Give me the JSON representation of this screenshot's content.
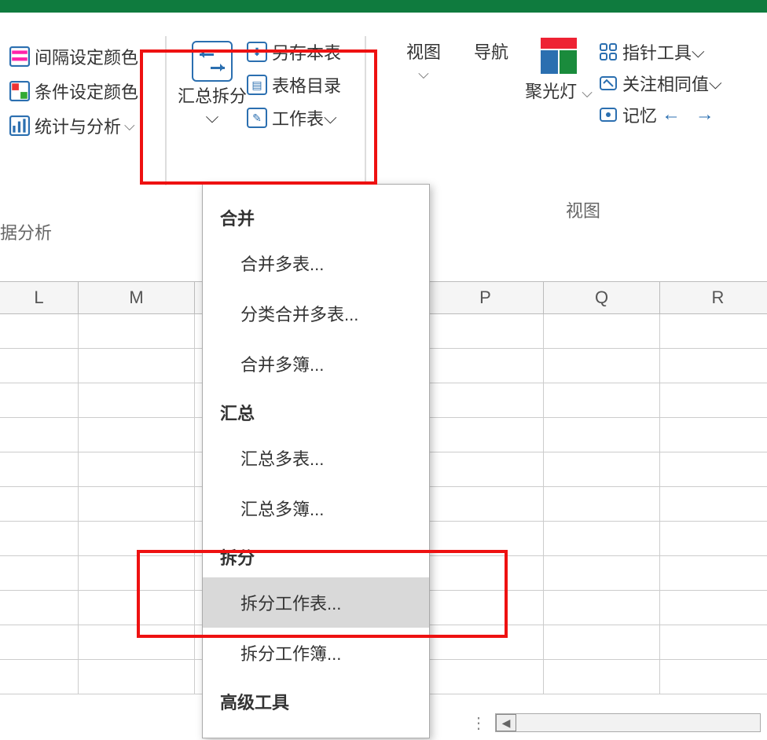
{
  "ribbon": {
    "left_group": {
      "interval_color": "间隔设定颜色",
      "conditional_color": "条件设定颜色",
      "stats_analysis": "统计与分析",
      "group_label": "据分析"
    },
    "style_group": {
      "summary_split": "汇总拆分",
      "save_table": "另存本表",
      "table_catalog": "表格目录",
      "worksheet": "工作表"
    },
    "view_group": {
      "view": "视图",
      "navigation": "导航",
      "spotlight": "聚光灯",
      "pointer_tool": "指针工具",
      "follow_same": "关注相同值",
      "memory": "记忆",
      "group_label": "视图"
    }
  },
  "menu": {
    "section_merge": "合并",
    "merge_tables": "合并多表...",
    "category_merge": "分类合并多表...",
    "merge_workbooks": "合并多簿...",
    "section_summary": "汇总",
    "summary_tables": "汇总多表...",
    "summary_workbooks": "汇总多簿...",
    "section_split": "拆分",
    "split_worksheet": "拆分工作表...",
    "split_workbook": "拆分工作簿...",
    "section_advanced": "高级工具"
  },
  "columns": [
    "L",
    "M",
    "",
    "",
    "P",
    "Q",
    "R"
  ]
}
